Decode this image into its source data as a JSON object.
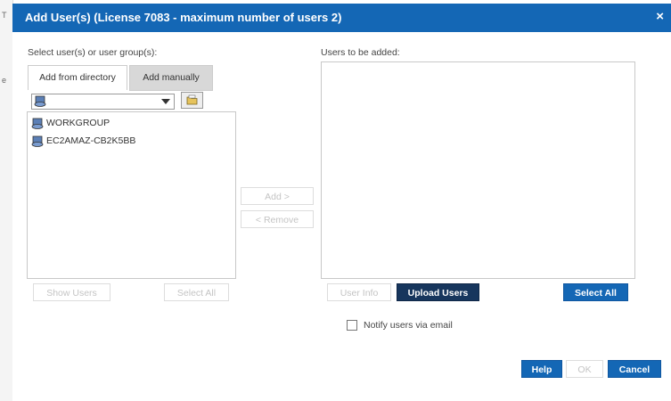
{
  "background": {
    "strip_letters": [
      "T",
      "e"
    ]
  },
  "dialog": {
    "title": "Add User(s) (License 7083 - maximum number of users 2)",
    "close_label": "×",
    "left_label": "Select user(s) or user group(s):",
    "right_label": "Users to be added:",
    "tabs": [
      {
        "label": "Add from directory",
        "active": true
      },
      {
        "label": "Add manually",
        "active": false
      }
    ],
    "directory_tree": [
      {
        "label": "WORKGROUP",
        "icon": "domain-icon"
      },
      {
        "label": "EC2AMAZ-CB2K5BB",
        "icon": "domain-icon"
      }
    ],
    "buttons": {
      "add": "Add >",
      "remove": "< Remove",
      "show_users": "Show Users",
      "select_all_left": "Select All",
      "user_info": "User Info",
      "upload_users": "Upload Users",
      "select_all_right": "Select All",
      "help": "Help",
      "ok": "OK",
      "cancel": "Cancel"
    },
    "notify_label": "Notify users via email",
    "notify_checked": false
  },
  "colors": {
    "titlebar": "#1467b5",
    "primary_button": "#1467b5",
    "upload_button": "#17365d",
    "disabled_text": "#c4c4c4"
  }
}
